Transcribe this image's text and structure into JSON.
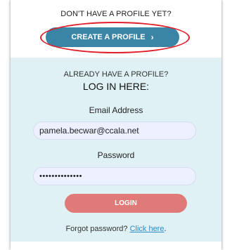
{
  "signup": {
    "prompt": "DON'T HAVE A PROFILE YET?",
    "create_button_label": "CREATE A PROFILE",
    "create_button_icon": "chevron-right-icon",
    "create_button_icon_glyph": "›"
  },
  "login": {
    "already_text": "ALREADY HAVE A PROFILE?",
    "heading": "LOG IN HERE:",
    "email_label": "Email Address",
    "email_value": "pamela.becwar@ccala.net",
    "password_label": "Password",
    "password_value": "••••••••••••••",
    "button_label": "LOGIN",
    "forgot_text": "Forgot password?",
    "forgot_link": "Click here",
    "forgot_end": "."
  },
  "colors": {
    "create_button": "#3a85a6",
    "login_panel": "#dff1f4",
    "login_button": "#df7a78",
    "highlight": "#e0202a",
    "link": "#2a8bc9"
  }
}
